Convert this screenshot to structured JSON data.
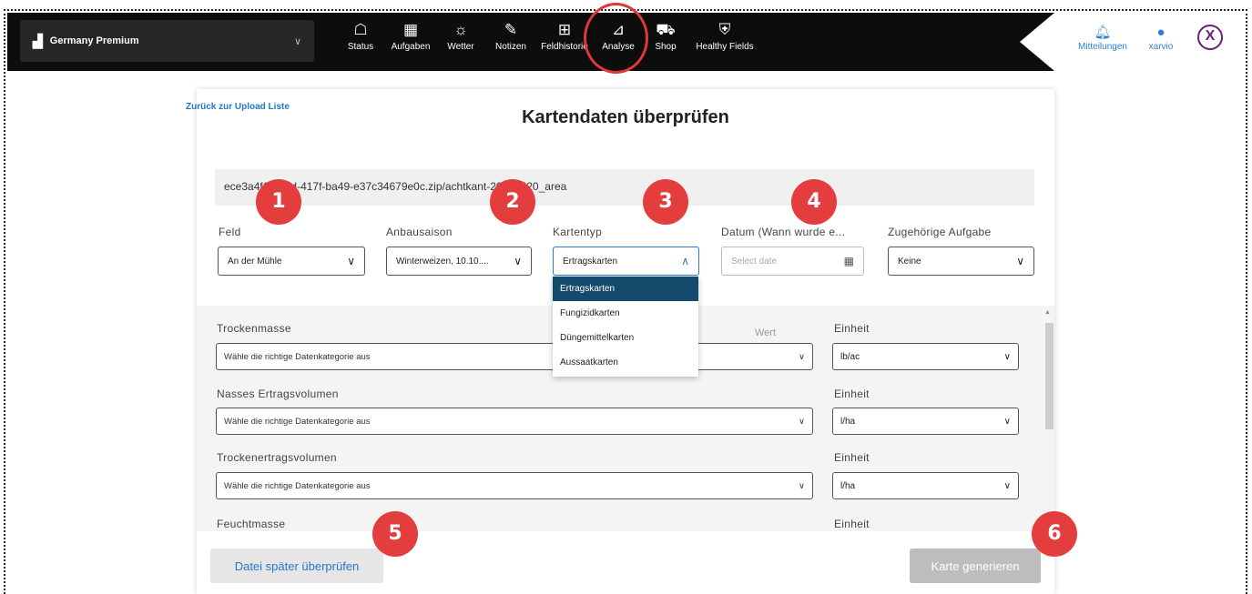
{
  "topbar": {
    "farm_icon": "farm-icon",
    "farm_name": "Germany Premium",
    "farm_chevron": "∨",
    "nav": [
      {
        "label": "Status",
        "icon": "☖"
      },
      {
        "label": "Aufgaben",
        "icon": "▦"
      },
      {
        "label": "Wetter",
        "icon": "☼"
      },
      {
        "label": "Notizen",
        "icon": "✎"
      },
      {
        "label": "Feldhistorie",
        "icon": "⊞"
      },
      {
        "label": "Analyse",
        "icon": "⊿"
      },
      {
        "label": "Shop",
        "icon": "⛟"
      },
      {
        "label": "Healthy Fields",
        "icon": "⛨"
      }
    ],
    "notifications_label": "Mitteilungen",
    "notifications_icon": "bell-icon",
    "user_label": "xarvio",
    "user_icon": "user-icon",
    "close_label": "X",
    "highlight_color": "#e03737"
  },
  "page": {
    "back_link": "Zurück zur Upload Liste",
    "title": "Kartendaten überprüfen",
    "file_name": "ece3a4f1-94dd-417f-ba49-e37c34679e0c.zip/achtkant-20200420_area"
  },
  "fields": {
    "feld_label": "Feld",
    "feld_value": "An der Mühle",
    "anbausaison_label": "Anbausaison",
    "anbausaison_value": "Winterweizen, 10.10....",
    "kartentyp_label": "Kartentyp",
    "kartentyp_value": "Ertragskarten",
    "datum_label": "Datum (Wann wurde e...",
    "datum_placeholder": "Select date",
    "aufgabe_label": "Zugehörige Aufgabe",
    "aufgabe_value": "Keine"
  },
  "dropdown": {
    "options": [
      "Ertragskarten",
      "Fungizidkarten",
      "Düngemittelkarten",
      "Aussaatkarten"
    ],
    "selected": "Ertragskarten"
  },
  "mapping": {
    "wert_label": "Wert",
    "rows": [
      {
        "label": "Trockenmasse",
        "category": "Wähle die richtige Datenkategorie aus",
        "unit_label": "Einheit",
        "unit": "lb/ac"
      },
      {
        "label": "Nasses Ertragsvolumen",
        "category": "Wähle die richtige Datenkategorie aus",
        "unit_label": "Einheit",
        "unit": "l/ha"
      },
      {
        "label": "Trockenertragsvolumen",
        "category": "Wähle die richtige Datenkategorie aus",
        "unit_label": "Einheit",
        "unit": "l/ha"
      },
      {
        "label": "Feuchtmasse",
        "unit_label": "Einheit"
      }
    ]
  },
  "buttons": {
    "later": "Datei später überprüfen",
    "generate": "Karte generieren"
  },
  "badges": [
    "1",
    "2",
    "3",
    "4",
    "5",
    "6"
  ],
  "colors": {
    "badge": "#e33d3d",
    "accent": "#2477c9",
    "dropdown_active": "#144a6b"
  }
}
